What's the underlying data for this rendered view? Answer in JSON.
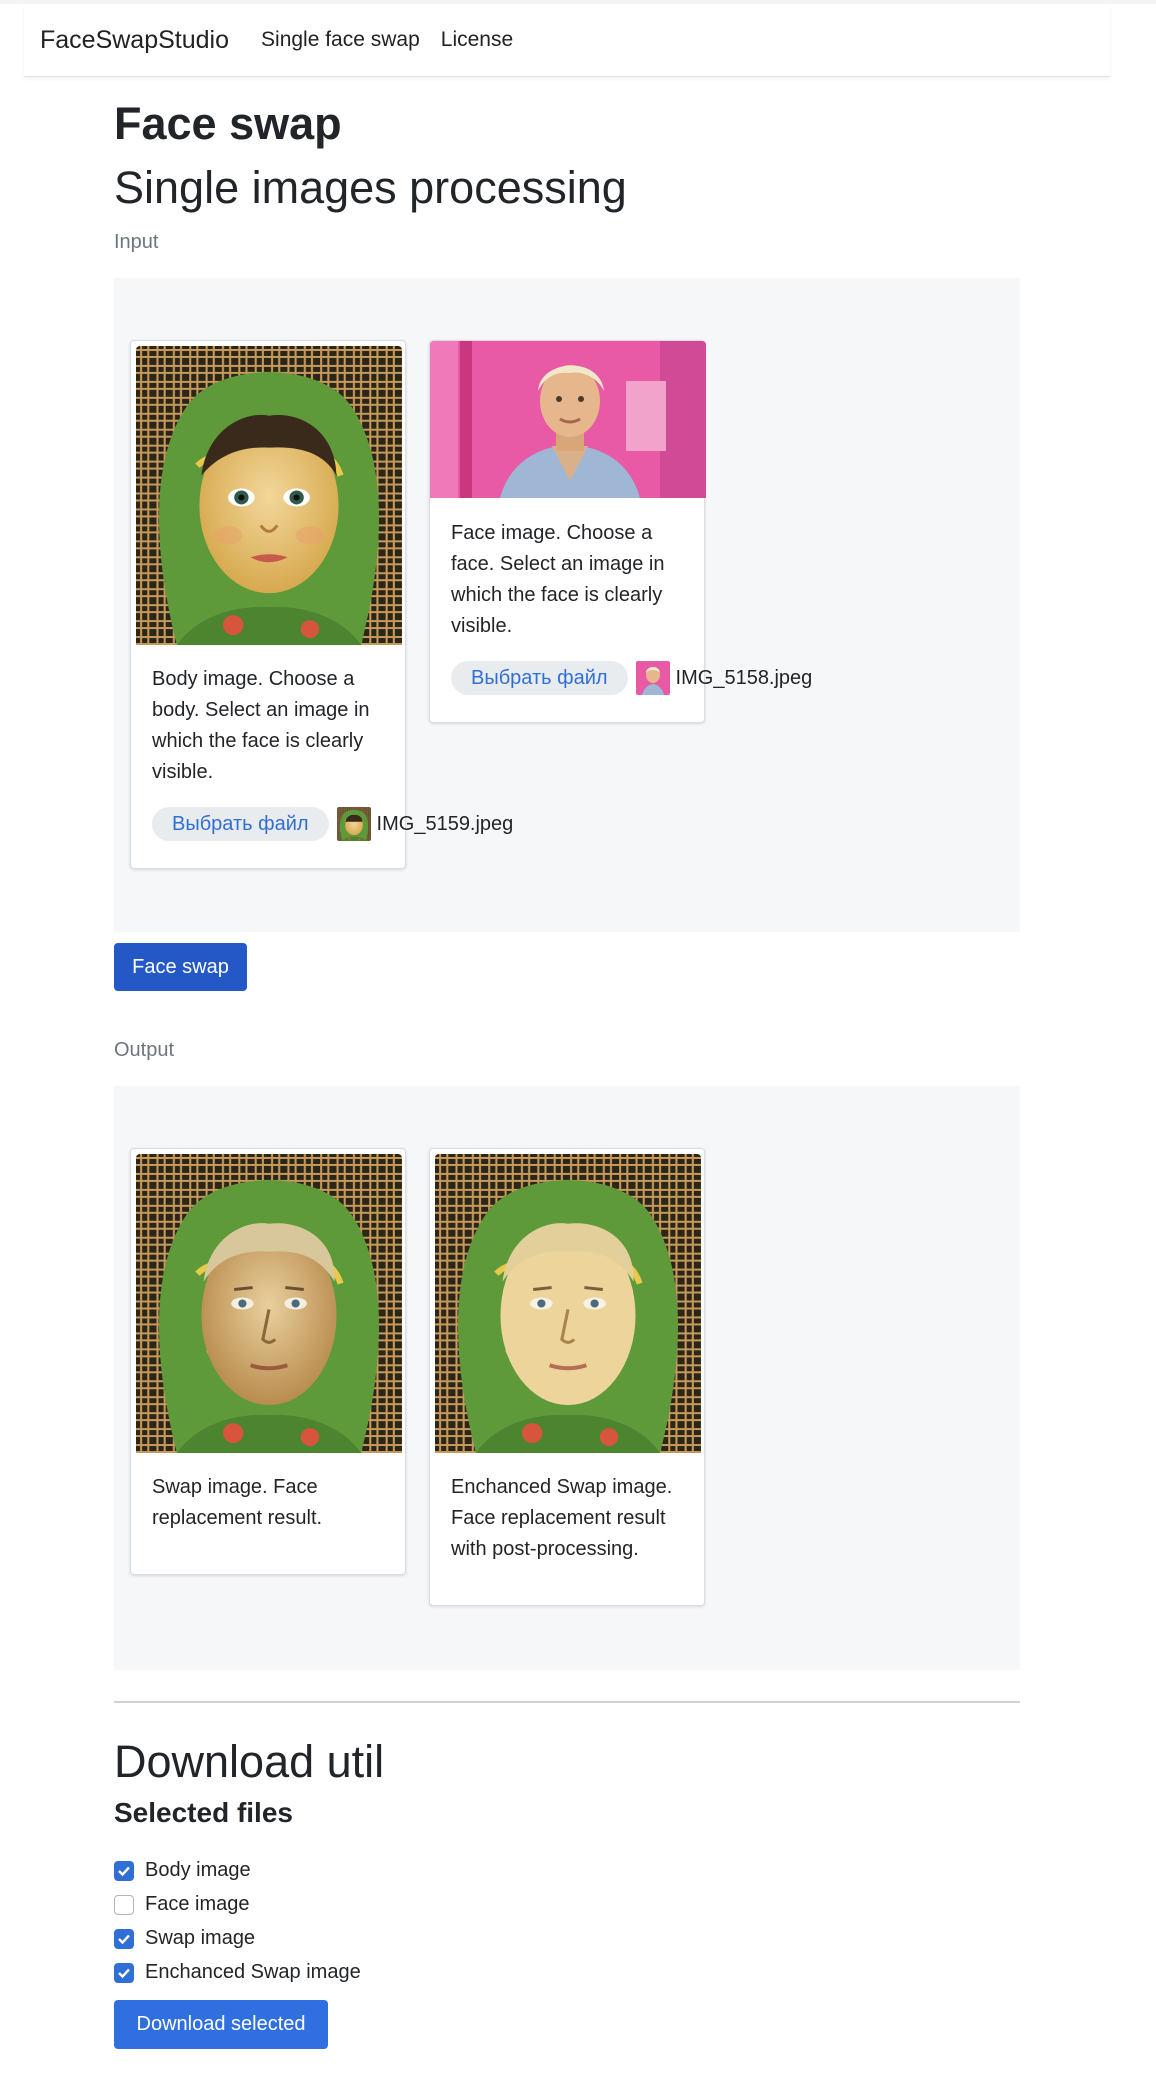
{
  "nav": {
    "brand": "FaceSwapStudio",
    "links": [
      "Single face swap",
      "License"
    ]
  },
  "headings": {
    "title": "Face swap",
    "subtitle": "Single images processing"
  },
  "input": {
    "label": "Input",
    "body_card": {
      "text": "Body image. Choose a body. Select an image in which the face is clearly visible.",
      "button": "Выбрать файл",
      "filename": "IMG_5159.jpeg"
    },
    "face_card": {
      "text": "Face image. Choose a face. Select an image in which the face is clearly visible.",
      "button": "Выбрать файл",
      "filename": "IMG_5158.jpeg"
    }
  },
  "face_swap_button": "Face swap",
  "output": {
    "label": "Output",
    "swap_card": {
      "text": "Swap image. Face replacement result."
    },
    "enhanced_card": {
      "text": "Enchanced Swap image. Face replacement result with post-processing."
    }
  },
  "download": {
    "title": "Download util",
    "subtitle": "Selected files",
    "options": [
      {
        "label": "Body image",
        "checked": true
      },
      {
        "label": "Face image",
        "checked": false
      },
      {
        "label": "Swap image",
        "checked": true
      },
      {
        "label": "Enchanced Swap image",
        "checked": true
      }
    ],
    "button": "Download selected"
  },
  "colors": {
    "primary": "#2458c6",
    "checkbox": "#2f6fd6",
    "panel_bg": "#f6f7f9"
  }
}
